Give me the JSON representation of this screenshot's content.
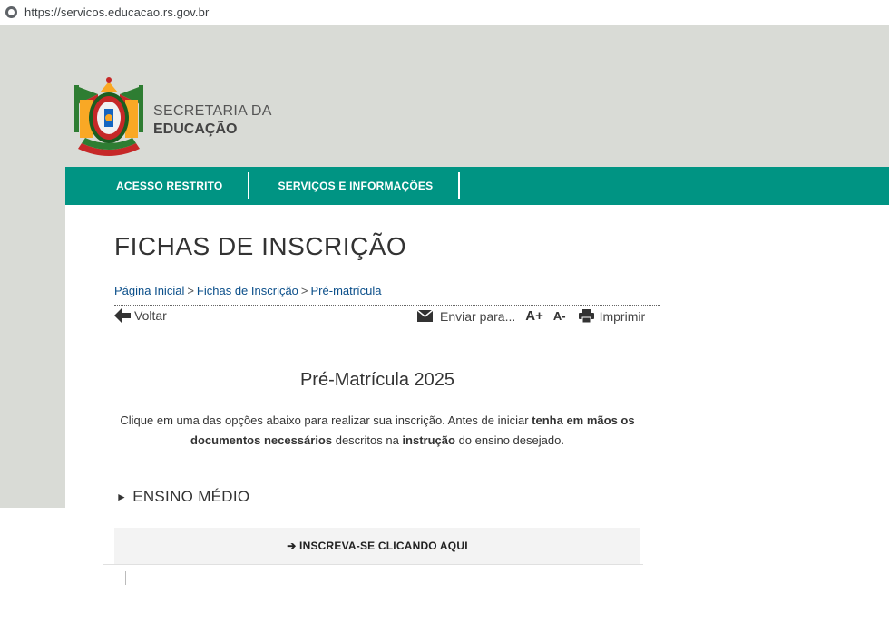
{
  "browser": {
    "url": "https://servicos.educacao.rs.gov.br"
  },
  "brand": {
    "line1": "SECRETARIA DA",
    "line2": "EDUCAÇÃO"
  },
  "nav": {
    "items": [
      {
        "label": "ACESSO RESTRITO"
      },
      {
        "label": "SERVIÇOS E INFORMAÇÕES"
      }
    ]
  },
  "page": {
    "title": "FICHAS DE INSCRIÇÃO"
  },
  "breadcrumb": {
    "items": [
      "Página Inicial",
      "Fichas de Inscrição",
      "Pré-matrícula"
    ],
    "separator": ">"
  },
  "toolbar": {
    "back": "Voltar",
    "send": "Enviar para...",
    "font_up": "A+",
    "font_down": "A-",
    "print": "Imprimir"
  },
  "section": {
    "title": "Pré-Matrícula 2025",
    "intro": {
      "part1": "Clique em uma das opções abaixo para realizar sua inscrição. Antes de iniciar ",
      "bold1": "tenha em mãos os documentos necessários",
      "part2": " descritos na ",
      "bold2": "instrução",
      "part3": " do ensino desejado."
    }
  },
  "accordion": {
    "marker": "►",
    "label": "ENSINO MÉDIO",
    "button": "➔ INSCREVA-SE CLICANDO AQUI"
  },
  "colors": {
    "nav": "#009483",
    "background": "#d9dbd6",
    "link": "#0b4f8a"
  }
}
